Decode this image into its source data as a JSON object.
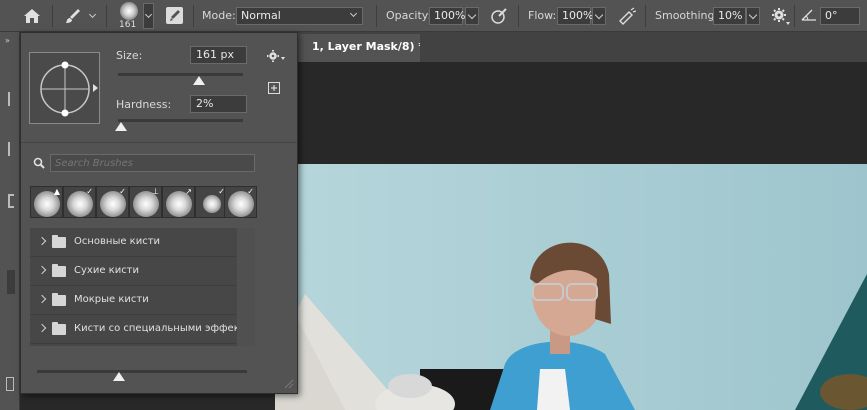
{
  "options_bar": {
    "brush_size_value": "161",
    "mode_label": "Mode:",
    "mode_value": "Normal",
    "opacity_label": "Opacity:",
    "opacity_value": "100%",
    "flow_label": "Flow:",
    "flow_value": "100%",
    "smoothing_label": "Smoothing:",
    "smoothing_value": "10%",
    "angle_value": "0°"
  },
  "document": {
    "tab_title": "1, Layer Mask/8) *"
  },
  "brush_panel": {
    "size_label": "Size:",
    "size_value": "161 px",
    "size_fraction": 0.65,
    "hardness_label": "Hardness:",
    "hardness_value": "2%",
    "hardness_fraction": 0.02,
    "search_placeholder": "Search Brushes",
    "folders": [
      {
        "name": "Основные кисти"
      },
      {
        "name": "Сухие кисти"
      },
      {
        "name": "Мокрые кисти"
      },
      {
        "name": "Кисти со специальными эффек..."
      }
    ],
    "preview_size_fraction": 0.39
  },
  "colors": {
    "panel_bg": "#535353",
    "field_bg": "#3c3c3c",
    "photo_wall": "#a9cdd4",
    "blazer": "#3e9fd0"
  }
}
